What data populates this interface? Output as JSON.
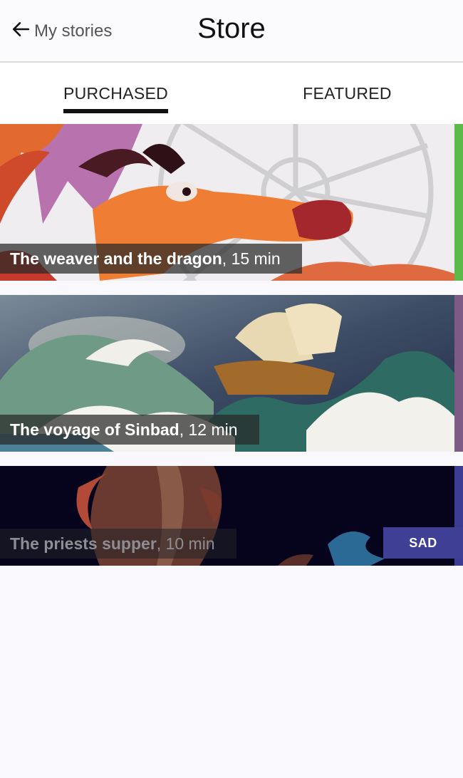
{
  "header": {
    "back_label": "My stories",
    "title": "Store"
  },
  "tabs": [
    {
      "label": "PURCHASED",
      "active": true
    },
    {
      "label": "FEATURED",
      "active": false
    }
  ],
  "stories": [
    {
      "name": "The weaver and the dragon",
      "duration": ", 15 min",
      "accent_color": "#5cba4a"
    },
    {
      "name": "The voyage of Sinbad",
      "duration": ", 12 min",
      "accent_color": "#7e5a86"
    },
    {
      "name": "The priests supper",
      "duration": ", 10 min",
      "accent_color": "#3c3c95",
      "tag": "SAD",
      "tag_color": "#3f3f95"
    }
  ],
  "icons": {
    "back": "arrow-left-icon"
  }
}
